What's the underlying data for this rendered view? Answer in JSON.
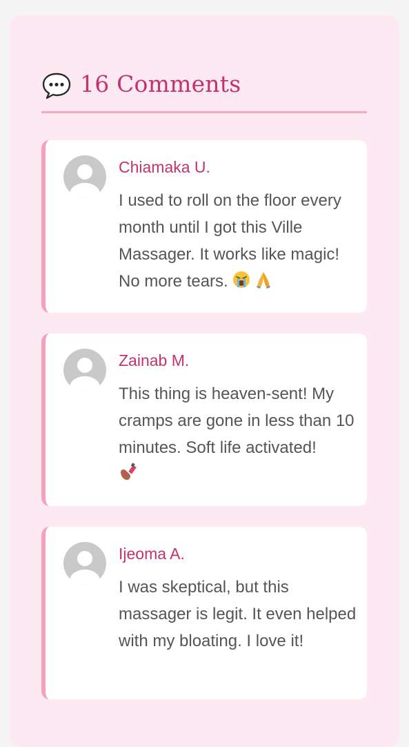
{
  "header": {
    "icon": "speech-bubble-icon",
    "title": "16 Comments"
  },
  "comments": [
    {
      "author": "Chiamaka U.",
      "text": "I used to roll on the floor every month until I got this Ville Massager. It works like magic! No more tears.",
      "emojis": [
        "loudly-crying-face-emoji",
        "folded-hands-emoji"
      ]
    },
    {
      "author": "Zainab M.",
      "text": "This thing is heaven-sent! My cramps are gone in less than 10 minutes. Soft life activated!",
      "emojis": [
        "nail-polish-emoji"
      ]
    },
    {
      "author": "Ijeoma A.",
      "text": "I was skeptical, but this massager is legit. It even helped with my bloating. I love it!",
      "emojis": []
    }
  ],
  "colors": {
    "accent": "#c2336e",
    "card_border": "#f7a0bc",
    "panel_background": "#fde9f1",
    "body_text": "#555555"
  }
}
